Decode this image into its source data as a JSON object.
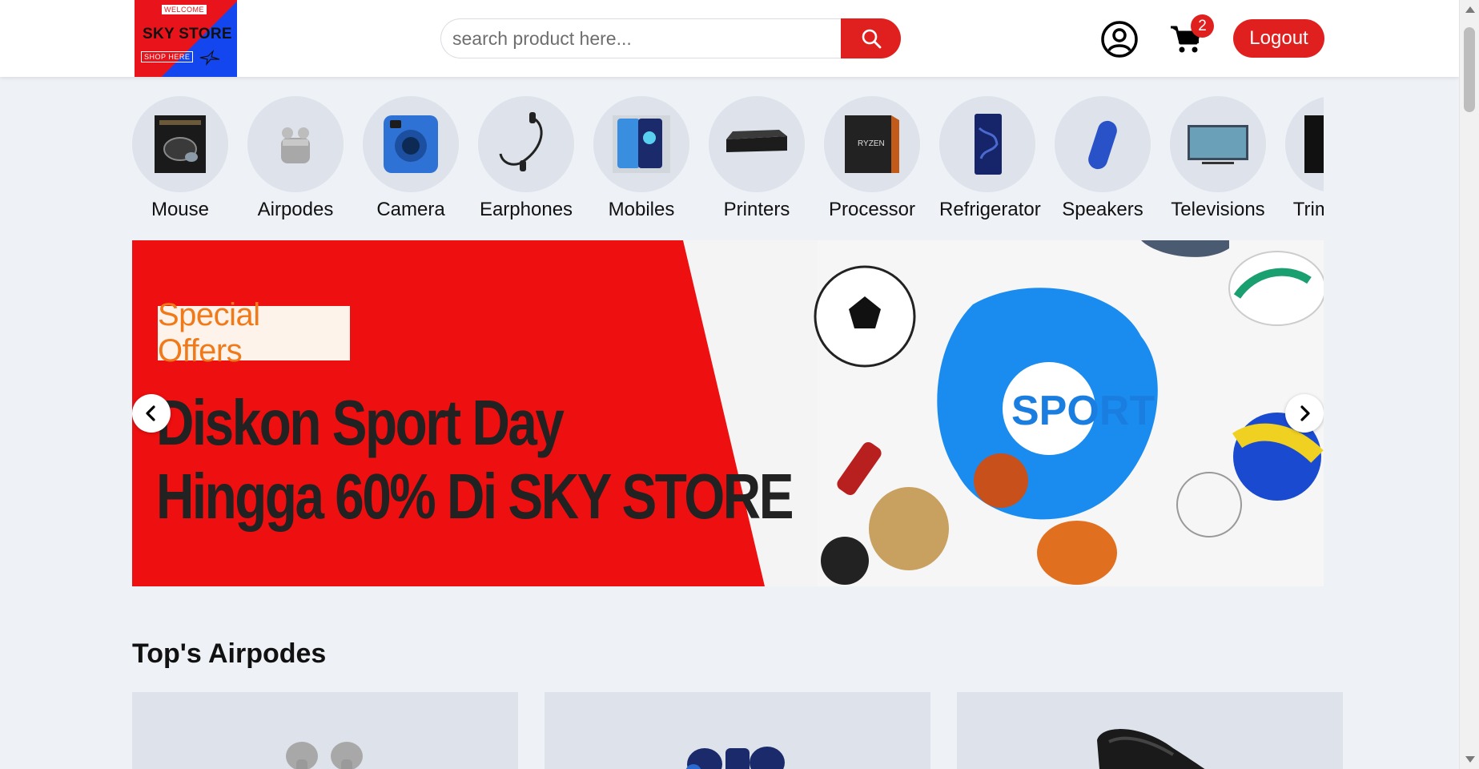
{
  "header": {
    "logo": {
      "welcome": "WELCOME",
      "name": "SKY STORE",
      "shop": "SHOP HERE"
    },
    "search": {
      "placeholder": "search product here...",
      "value": ""
    },
    "icons": {
      "search": "search-icon",
      "user": "user-circle-icon",
      "cart": "cart-icon"
    },
    "cart_count": "2",
    "logout_label": "Logout"
  },
  "categories": [
    {
      "label": "Mouse",
      "icon": "mouse-image"
    },
    {
      "label": "Airpodes",
      "icon": "airpods-image"
    },
    {
      "label": "Camera",
      "icon": "camera-image"
    },
    {
      "label": "Earphones",
      "icon": "earphones-image"
    },
    {
      "label": "Mobiles",
      "icon": "mobile-image"
    },
    {
      "label": "Printers",
      "icon": "printer-image"
    },
    {
      "label": "Processor",
      "icon": "processor-image"
    },
    {
      "label": "Refrigerator",
      "icon": "refrigerator-image"
    },
    {
      "label": "Speakers",
      "icon": "speaker-image"
    },
    {
      "label": "Televisions",
      "icon": "television-image"
    },
    {
      "label": "Trimmers",
      "icon": "trimmer-image"
    }
  ],
  "banner": {
    "tag": "Special Offers",
    "line1": "Diskon Sport Day",
    "line2": "Hingga 60% Di SKY STORE",
    "badge": "SPORT",
    "prev_icon": "chevron-left-icon",
    "next_icon": "chevron-right-icon"
  },
  "section": {
    "title": "Top's Airpodes"
  },
  "colors": {
    "accent": "#e0201f",
    "background": "#eef1f6",
    "card": "#dde2eb",
    "banner_red": "#ee0f10",
    "logo_blue": "#1446f0"
  }
}
